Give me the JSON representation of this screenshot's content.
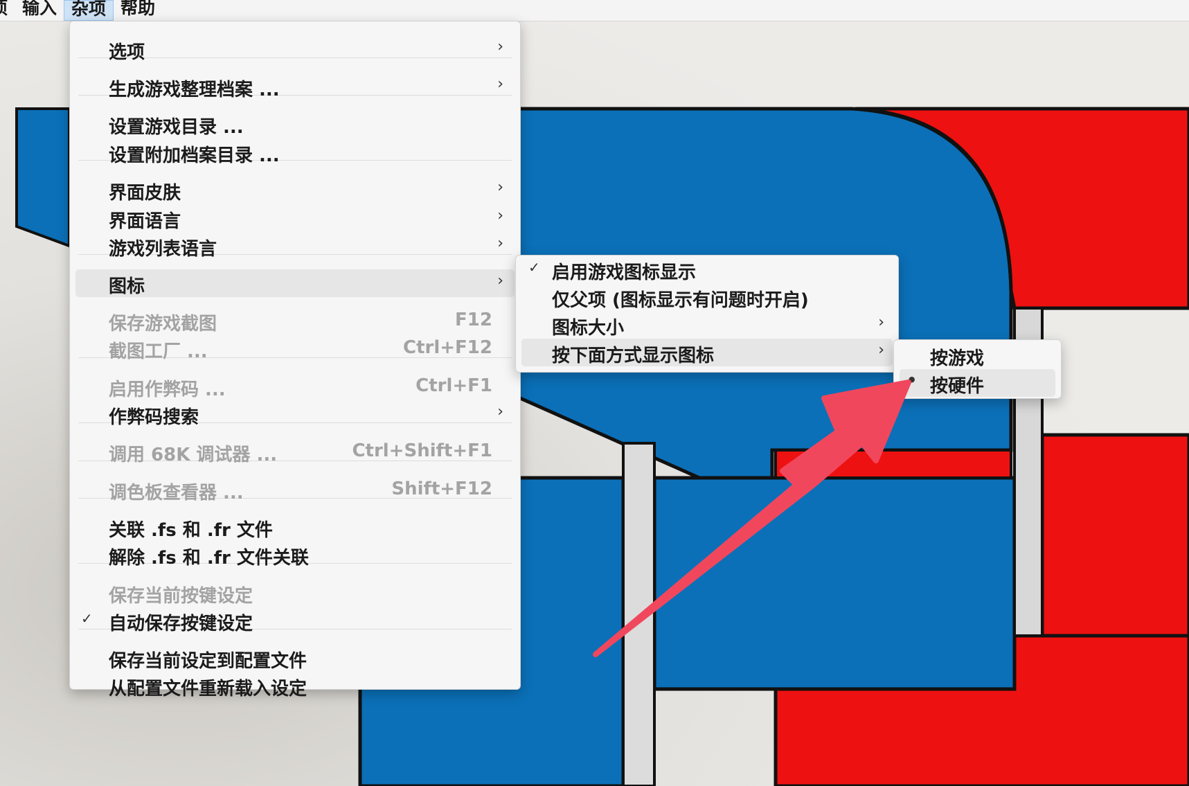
{
  "menubar": {
    "items": [
      {
        "label": "项"
      },
      {
        "label": "输入"
      },
      {
        "label": "杂项"
      },
      {
        "label": "帮助"
      }
    ]
  },
  "main_menu": {
    "items": [
      {
        "label": "选项",
        "shortcut": "",
        "submenu": true,
        "enabled": true,
        "checked": false
      },
      {
        "label": "生成游戏整理档案 ...",
        "shortcut": "",
        "submenu": true,
        "enabled": true,
        "checked": false
      },
      {
        "label": "设置游戏目录 ...",
        "shortcut": "",
        "submenu": false,
        "enabled": true,
        "checked": false
      },
      {
        "label": "设置附加档案目录 ...",
        "shortcut": "",
        "submenu": false,
        "enabled": true,
        "checked": false
      },
      {
        "label": "界面皮肤",
        "shortcut": "",
        "submenu": true,
        "enabled": true,
        "checked": false
      },
      {
        "label": "界面语言",
        "shortcut": "",
        "submenu": true,
        "enabled": true,
        "checked": false
      },
      {
        "label": "游戏列表语言",
        "shortcut": "",
        "submenu": true,
        "enabled": true,
        "checked": false
      },
      {
        "label": "图标",
        "shortcut": "",
        "submenu": true,
        "enabled": true,
        "checked": false,
        "highlighted": true
      },
      {
        "label": "保存游戏截图",
        "shortcut": "F12",
        "submenu": false,
        "enabled": false,
        "checked": false
      },
      {
        "label": "截图工厂 ...",
        "shortcut": "Ctrl+F12",
        "submenu": false,
        "enabled": false,
        "checked": false
      },
      {
        "label": "启用作弊码 ...",
        "shortcut": "Ctrl+F1",
        "submenu": false,
        "enabled": false,
        "checked": false
      },
      {
        "label": "作弊码搜索",
        "shortcut": "",
        "submenu": true,
        "enabled": true,
        "checked": false
      },
      {
        "label": "调用 68K 调试器 ...",
        "shortcut": "Ctrl+Shift+F1",
        "submenu": false,
        "enabled": false,
        "checked": false
      },
      {
        "label": "调色板查看器 ...",
        "shortcut": "Shift+F12",
        "submenu": false,
        "enabled": false,
        "checked": false
      },
      {
        "label": "关联 .fs 和 .fr 文件",
        "shortcut": "",
        "submenu": false,
        "enabled": true,
        "checked": false
      },
      {
        "label": "解除 .fs 和 .fr 文件关联",
        "shortcut": "",
        "submenu": false,
        "enabled": true,
        "checked": false
      },
      {
        "label": "保存当前按键设定",
        "shortcut": "",
        "submenu": false,
        "enabled": false,
        "checked": false
      },
      {
        "label": "自动保存按键设定",
        "shortcut": "",
        "submenu": false,
        "enabled": true,
        "checked": true
      },
      {
        "label": "保存当前设定到配置文件",
        "shortcut": "",
        "submenu": false,
        "enabled": true,
        "checked": false
      },
      {
        "label": "从配置文件重新载入设定",
        "shortcut": "",
        "submenu": false,
        "enabled": true,
        "checked": false
      }
    ]
  },
  "icons_menu": {
    "items": [
      {
        "label": "启用游戏图标显示",
        "submenu": false,
        "checked": true
      },
      {
        "label": "仅父项 (图标显示有问题时开启)",
        "submenu": false,
        "checked": false
      },
      {
        "label": "图标大小",
        "submenu": true,
        "checked": false
      },
      {
        "label": "按下面方式显示图标",
        "submenu": true,
        "checked": false,
        "highlighted": true
      }
    ]
  },
  "display_mode_menu": {
    "items": [
      {
        "label": "按游戏",
        "selected": false
      },
      {
        "label": "按硬件",
        "selected": true,
        "highlighted": true
      }
    ]
  },
  "glyphs": {
    "submenu_arrow": "›",
    "check": "✓",
    "radio": "•"
  },
  "colors": {
    "blue": "#0b70b8",
    "red": "#ee1111",
    "annotation_arrow": "#f0475d"
  }
}
